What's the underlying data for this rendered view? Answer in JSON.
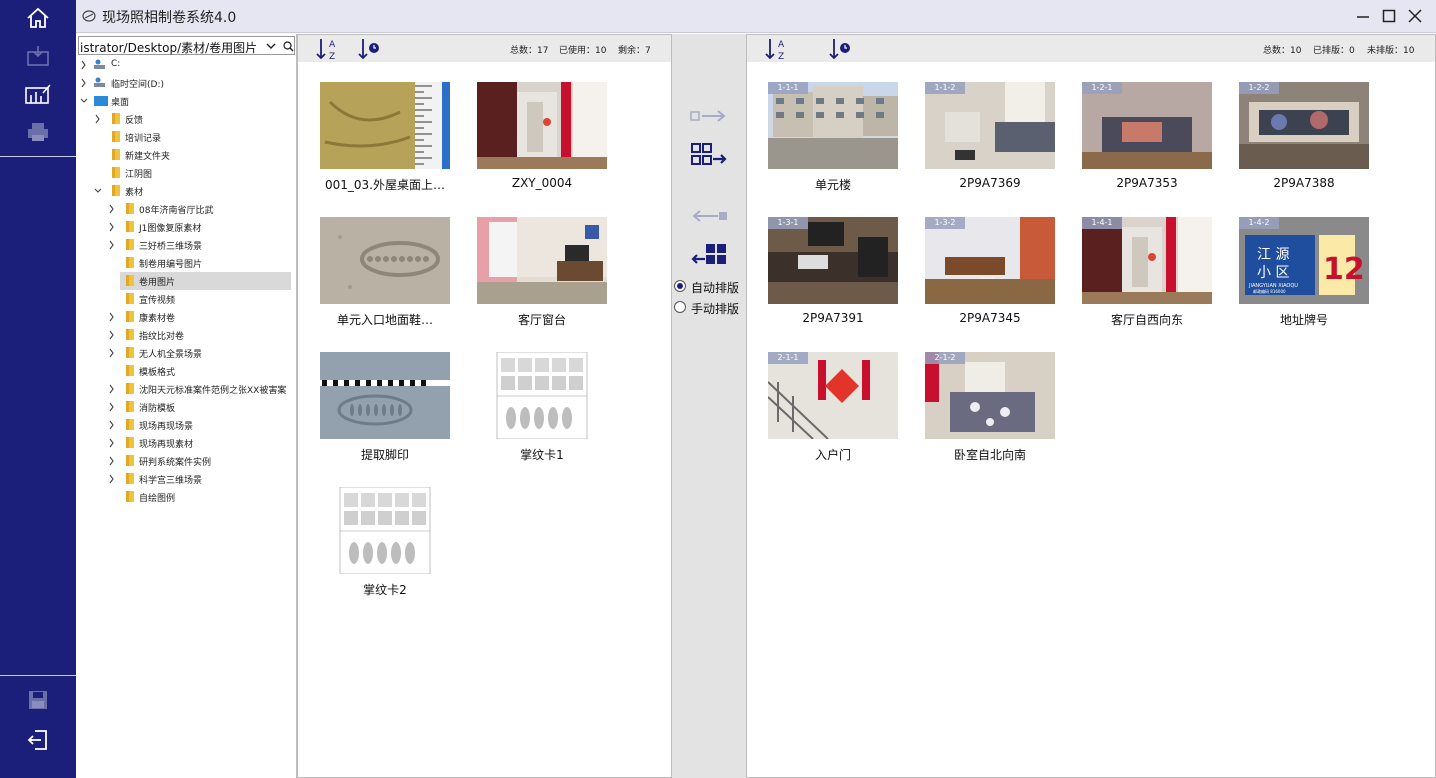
{
  "window": {
    "title": "现场照相制卷系统4.0"
  },
  "rail": {
    "icons": [
      "home-icon",
      "import-icon",
      "chart-edit-icon",
      "print-icon",
      "save-icon",
      "logout-icon"
    ]
  },
  "tree": {
    "path": "istrator/Desktop/素材/卷用图片",
    "nodes": [
      {
        "label": "C:",
        "level": 0,
        "type": "drive",
        "toggle": "›"
      },
      {
        "label": "临时空间(D:)",
        "level": 0,
        "type": "drive",
        "toggle": "›"
      },
      {
        "label": "桌面",
        "level": 0,
        "type": "desktop",
        "toggle": "⌄"
      },
      {
        "label": "反馈",
        "level": 1,
        "type": "folder",
        "toggle": "›"
      },
      {
        "label": "培训记录",
        "level": 1,
        "type": "folder",
        "toggle": ""
      },
      {
        "label": "新建文件夹",
        "level": 1,
        "type": "folder",
        "toggle": ""
      },
      {
        "label": "江阴图",
        "level": 1,
        "type": "folder",
        "toggle": ""
      },
      {
        "label": "素材",
        "level": 1,
        "type": "folder",
        "toggle": "⌄"
      },
      {
        "label": "08年济南省厅比武",
        "level": 2,
        "type": "folder",
        "toggle": "›"
      },
      {
        "label": "J1图像复原素材",
        "level": 2,
        "type": "folder",
        "toggle": "›"
      },
      {
        "label": "三好桥三维场景",
        "level": 2,
        "type": "folder",
        "toggle": "›"
      },
      {
        "label": "制卷用编号图片",
        "level": 2,
        "type": "folder",
        "toggle": ""
      },
      {
        "label": "卷用图片",
        "level": 2,
        "type": "folder",
        "toggle": "",
        "selected": true
      },
      {
        "label": "宣传视频",
        "level": 2,
        "type": "folder",
        "toggle": ""
      },
      {
        "label": "康素材卷",
        "level": 2,
        "type": "folder",
        "toggle": "›"
      },
      {
        "label": "指纹比对卷",
        "level": 2,
        "type": "folder",
        "toggle": "›"
      },
      {
        "label": "无人机全景场景",
        "level": 2,
        "type": "folder",
        "toggle": "›"
      },
      {
        "label": "模板格式",
        "level": 2,
        "type": "folder",
        "toggle": ""
      },
      {
        "label": "沈阳天元标准案件范例之张XX被害案",
        "level": 2,
        "type": "folder",
        "toggle": "›"
      },
      {
        "label": "消防模板",
        "level": 2,
        "type": "folder",
        "toggle": "›"
      },
      {
        "label": "现场再现场景",
        "level": 2,
        "type": "folder",
        "toggle": "›"
      },
      {
        "label": "现场再现素材",
        "level": 2,
        "type": "folder",
        "toggle": "›"
      },
      {
        "label": "研判系统案件实例",
        "level": 2,
        "type": "folder",
        "toggle": "›"
      },
      {
        "label": "科学宫三维场景",
        "level": 2,
        "type": "folder",
        "toggle": "›"
      },
      {
        "label": "自绘图例",
        "level": 2,
        "type": "folder",
        "toggle": ""
      }
    ]
  },
  "source": {
    "stats": {
      "total": "总数：17",
      "used": "已使用：10",
      "remain": "剩余：7"
    },
    "items": [
      {
        "caption": "001_03.外屋桌面上…",
        "kind": "ruler"
      },
      {
        "caption": "ZXY_0004",
        "kind": "door"
      },
      {
        "caption": "单元入口地面鞋…",
        "kind": "shoeprint"
      },
      {
        "caption": "客厅窗台",
        "kind": "living"
      },
      {
        "caption": "提取脚印",
        "kind": "footprint"
      },
      {
        "caption": "掌纹卡1",
        "kind": "card"
      },
      {
        "caption": "掌纹卡2",
        "kind": "card"
      }
    ]
  },
  "target": {
    "stats": {
      "total": "总数：10",
      "arranged": "已排版：0",
      "unarranged": "未排版：10"
    },
    "items": [
      {
        "caption": "单元楼",
        "badge": "1-1-1",
        "kind": "building"
      },
      {
        "caption": "2P9A7369",
        "badge": "1-1-2",
        "kind": "bedroom"
      },
      {
        "caption": "2P9A7353",
        "badge": "1-2-1",
        "kind": "bed"
      },
      {
        "caption": "2P9A7388",
        "badge": "1-2-2",
        "kind": "sofa"
      },
      {
        "caption": "2P9A7391",
        "badge": "1-3-1",
        "kind": "desk"
      },
      {
        "caption": "2P9A7345",
        "badge": "1-3-2",
        "kind": "office"
      },
      {
        "caption": "客厅自西向东",
        "badge": "1-4-1",
        "kind": "door"
      },
      {
        "caption": "地址牌号",
        "badge": "1-4-2",
        "kind": "sign"
      },
      {
        "caption": "入户门",
        "badge": "2-1-1",
        "kind": "stairs"
      },
      {
        "caption": "卧室自北向南",
        "badge": "2-1-2",
        "kind": "bed2"
      }
    ]
  },
  "sign": {
    "line1": "江 源",
    "line2": "小 区",
    "number": "12",
    "sub": "JIANGYUAN XIAOQU",
    "post": "邮政编码 816000"
  },
  "mid": {
    "auto": "自动排版",
    "manual": "手动排版"
  },
  "sort_az": {
    "a": "A",
    "z": "Z"
  },
  "colors": {
    "rail": "#1c1f7a",
    "accent": "#1c1f7a"
  }
}
